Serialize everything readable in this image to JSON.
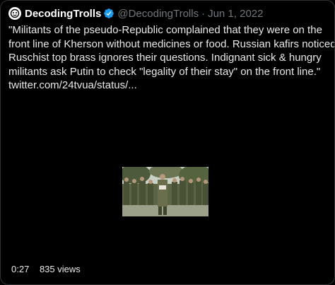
{
  "tweet": {
    "author": {
      "display_name": "DecodingTrolls",
      "handle": "@DecodingTrolls",
      "avatar_icon": "decodingtrolls-logo-icon",
      "verified_icon": "verified-badge-icon",
      "verified_color": "#1d9bf0"
    },
    "separator": "·",
    "date": "Jun 1, 2022",
    "text_lines": [
      "\"Militants of the pseudo-Republic complained that they were on the",
      "front line of Kherson without medicines or food. Russian kafirs noticed",
      "Ruschist top brass ignores their questions. Indignant sick & hungry",
      "militants ask Putin to check \"legality of their stay\" on the front line.\"",
      "twitter.com/24tvua/status/..."
    ],
    "video": {
      "duration": "0:27",
      "views": "835 views"
    }
  },
  "colors": {
    "background": "#000000",
    "text": "#e7e9ea",
    "secondary_text": "#71767b",
    "border": "#2f3336"
  }
}
